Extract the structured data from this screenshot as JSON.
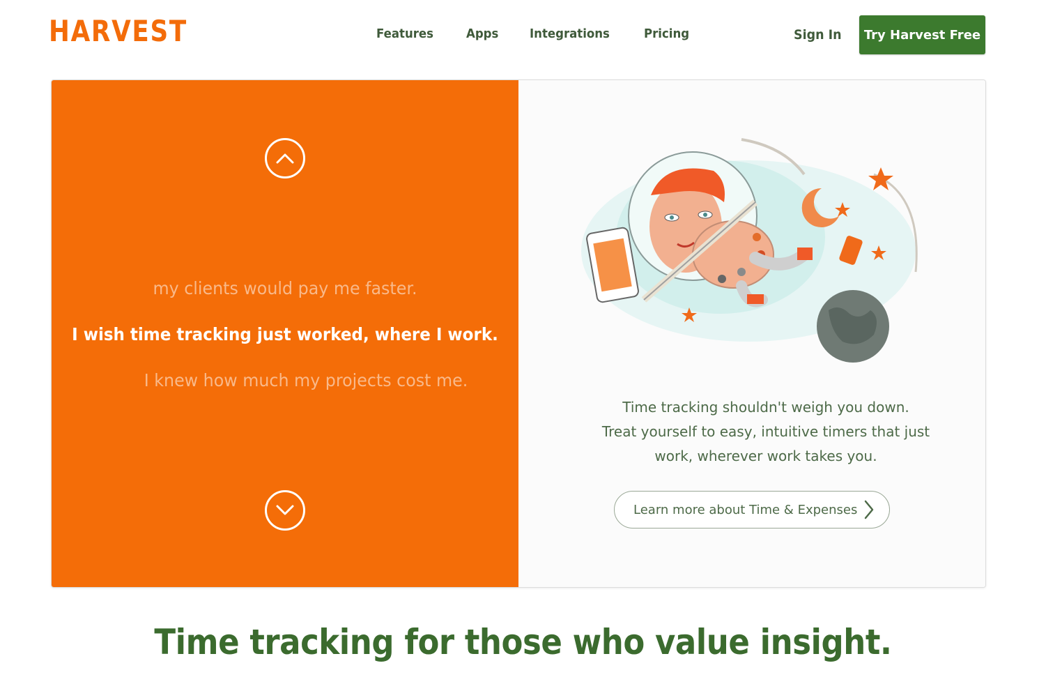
{
  "header": {
    "logo": "HARVEST",
    "nav": [
      "Features",
      "Apps",
      "Integrations",
      "Pricing"
    ],
    "sign_in": "Sign In",
    "cta": "Try Harvest Free"
  },
  "hero": {
    "left": {
      "up_icon": "chevron-up-icon",
      "down_icon": "chevron-down-icon",
      "phrase_prev": "my clients would pay me faster.",
      "phrase_current": "I wish time tracking just worked, where I work.",
      "phrase_next": "I knew how much my projects cost me."
    },
    "right": {
      "illustration": "astronaut-painter-illustration",
      "text_lines": [
        "Time tracking shouldn't weigh you down.",
        "Treat yourself to easy, intuitive timers that just",
        "work, wherever work takes you."
      ],
      "learn_more": "Learn more about Time & Expenses",
      "learn_more_icon": "chevron-right-icon"
    }
  },
  "tagline": "Time tracking for those who value insight.",
  "colors": {
    "brand_orange": "#f46d08",
    "brand_green": "#3c7a2e",
    "text_green": "#4d6a48"
  }
}
